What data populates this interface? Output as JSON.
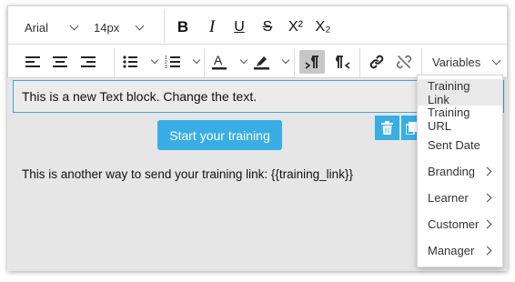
{
  "toolbar": {
    "font_family": "Arial",
    "font_size": "14px",
    "bold_label": "B",
    "italic_label": "I",
    "underline_label": "U",
    "strike_label": "S",
    "superscript_label": "X²",
    "subscript_label": "X₂",
    "variables_label": "Variables"
  },
  "editor": {
    "text_block": "This is a new Text block. Change the text.",
    "button_label": "Start your training",
    "paragraph": "This is another way to send your training link: {{training_link}}"
  },
  "menu": {
    "items": [
      {
        "label": "Training Link",
        "highlighted": true,
        "submenu": false
      },
      {
        "label": "Training URL",
        "highlighted": false,
        "submenu": false
      },
      {
        "label": "Sent Date",
        "highlighted": false,
        "submenu": false
      },
      {
        "label": "Branding",
        "highlighted": false,
        "submenu": true
      },
      {
        "label": "Learner",
        "highlighted": false,
        "submenu": true
      },
      {
        "label": "Customer",
        "highlighted": false,
        "submenu": true
      },
      {
        "label": "Manager",
        "highlighted": false,
        "submenu": true
      }
    ]
  },
  "colors": {
    "accent": "#39aee4",
    "selection_border": "#4aa3d8",
    "canvas": "#e6e6e6"
  }
}
